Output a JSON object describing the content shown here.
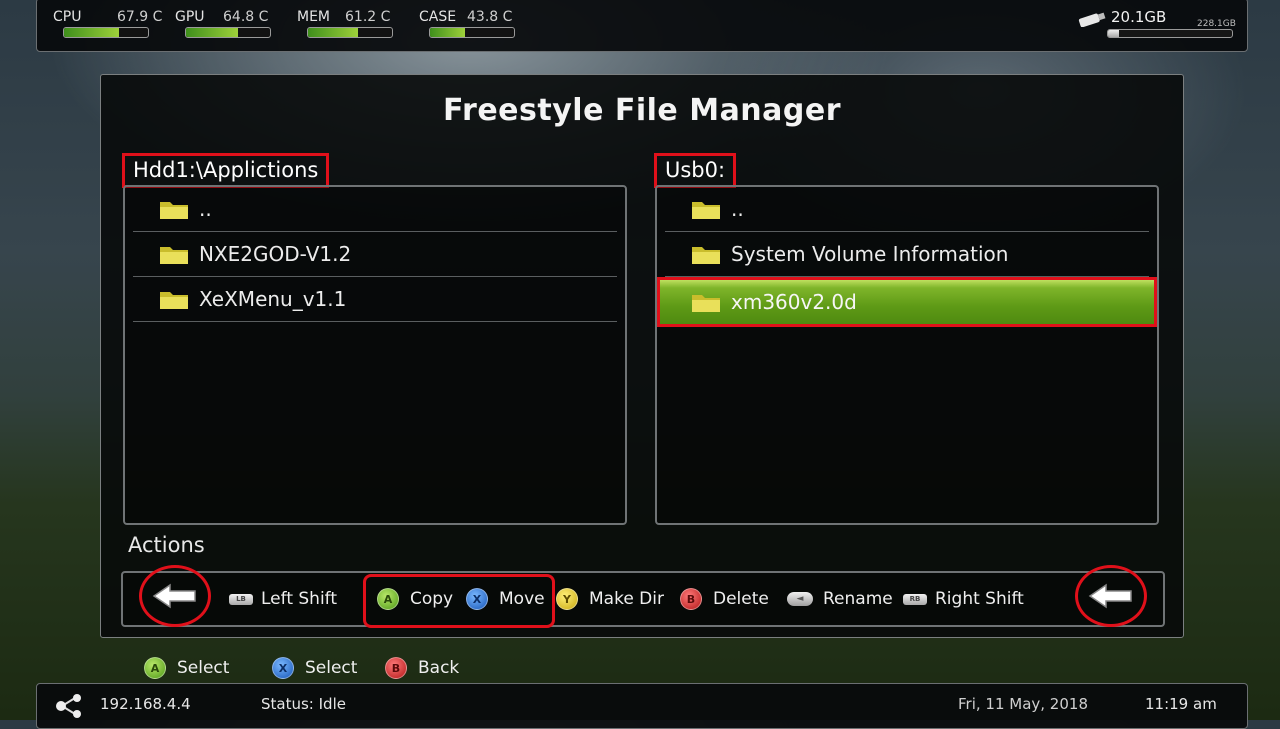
{
  "sensors": [
    {
      "label": "CPU",
      "value": "67.9 C",
      "level": 0.65
    },
    {
      "label": "GPU",
      "value": "64.8 C",
      "level": 0.62
    },
    {
      "label": "MEM",
      "value": "61.2 C",
      "level": 0.59
    },
    {
      "label": "CASE",
      "value": "43.8 C",
      "level": 0.42
    }
  ],
  "drive": {
    "free": "20.1GB",
    "total": "228.1GB",
    "used_fraction": 0.09,
    "icon": "usb-drive-icon"
  },
  "window": {
    "title": "Freestyle File Manager"
  },
  "left_pane": {
    "path": "Hdd1:\\Applictions",
    "items": [
      "..",
      "NXE2GOD-V1.2",
      "XeXMenu_v1.1"
    ]
  },
  "right_pane": {
    "path": "Usb0:",
    "items": [
      "..",
      "System Volume Information",
      "xm360v2.0d"
    ],
    "selected_index": 2
  },
  "actions": {
    "label": "Actions",
    "left_shift": {
      "button": "LB",
      "label": "Left Shift"
    },
    "copy": {
      "button": "A",
      "label": "Copy"
    },
    "move": {
      "button": "X",
      "label": "Move"
    },
    "make_dir": {
      "button": "Y",
      "label": "Make Dir"
    },
    "delete": {
      "button": "B",
      "label": "Delete"
    },
    "rename": {
      "button": "◄",
      "label": "Rename"
    },
    "right_shift": {
      "button": "RB",
      "label": "Right Shift"
    }
  },
  "footer": {
    "select_a": {
      "button": "A",
      "label": "Select"
    },
    "select_x": {
      "button": "X",
      "label": "Select"
    },
    "back": {
      "button": "B",
      "label": "Back"
    }
  },
  "status_bar": {
    "ip": "192.168.4.4",
    "status": "Status: Idle",
    "date": "Fri, 11 May, 2018",
    "time": "11:19 am"
  },
  "colors": {
    "highlight_red": "#e0101a",
    "selection_green": "#5e9a16",
    "button_a": "#4f9a16",
    "button_x": "#1656b8",
    "button_y": "#c9a90f",
    "button_b": "#b31616"
  }
}
